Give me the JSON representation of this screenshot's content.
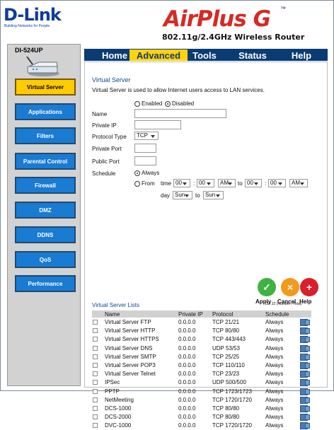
{
  "brand": {
    "name": "D-Link",
    "tagline": "Building Networks for People",
    "product": "AirPlus G",
    "tm": "™",
    "subtitle": "802.11g/2.4GHz Wireless Router",
    "model": "DI-524UP"
  },
  "nav": [
    {
      "label": "Virtual Server"
    },
    {
      "label": "Applications"
    },
    {
      "label": "Filters"
    },
    {
      "label": "Parental Control"
    },
    {
      "label": "Firewall"
    },
    {
      "label": "DMZ"
    },
    {
      "label": "DDNS"
    },
    {
      "label": "QoS"
    },
    {
      "label": "Performance"
    }
  ],
  "tabs": [
    {
      "label": "Home"
    },
    {
      "label": "Advanced"
    },
    {
      "label": "Tools"
    },
    {
      "label": "Status"
    },
    {
      "label": "Help"
    }
  ],
  "form": {
    "title": "Virtual Server",
    "description": "Virtual Server is used to allow Internet users access to LAN services.",
    "enabled": "Enabled",
    "disabled": "Disabled",
    "name_label": "Name",
    "private_ip_label": "Private IP",
    "protocol_label": "Protocol Type",
    "protocol_value": "TCP",
    "private_port_label": "Private Port",
    "public_port_label": "Public Port",
    "schedule_label": "Schedule",
    "always": "Always",
    "from": "From",
    "time": "time",
    "hour1": "00",
    "minute1": "00",
    "ampm1": "AM",
    "to": "to",
    "hour2": "00",
    "minute2": "00",
    "ampm2": "AM",
    "day": "day",
    "day_from": "Sun",
    "day_to": "Sun"
  },
  "actions": [
    {
      "label": "Apply"
    },
    {
      "label": "Cancel"
    },
    {
      "label": "Help"
    }
  ],
  "list": {
    "title": "Virtual Server Lists",
    "count": "13 / 32 (Number / Total)",
    "headers": [
      "Name",
      "Private IP",
      "Protocol",
      "Schedule"
    ],
    "rows": [
      [
        "Virtual Server FTP",
        "0.0.0.0",
        "TCP 21/21",
        "Always"
      ],
      [
        "Virtual Server HTTP",
        "0.0.0.0",
        "TCP 80/80",
        "Always"
      ],
      [
        "Virtual Server HTTPS",
        "0.0.0.0",
        "TCP 443/443",
        "Always"
      ],
      [
        "Virtual Server DNS",
        "0.0.0.0",
        "UDP 53/53",
        "Always"
      ],
      [
        "Virtual Server SMTP",
        "0.0.0.0",
        "TCP 25/25",
        "Always"
      ],
      [
        "Virtual Server POP3",
        "0.0.0.0",
        "TCP 110/110",
        "Always"
      ],
      [
        "Virtual Server Telnet",
        "0.0.0.0",
        "TCP 23/23",
        "Always"
      ],
      [
        "IPSec",
        "0.0.0.0",
        "UDP 500/500",
        "Always"
      ],
      [
        "PPTP",
        "0.0.0.0",
        "TCP 1723/1723",
        "Always"
      ],
      [
        "NetMeeting",
        "0.0.0.0",
        "TCP 1720/1720",
        "Always"
      ],
      [
        "DCS-1000",
        "0.0.0.0",
        "TCP 80/80",
        "Always"
      ],
      [
        "DCS-2000",
        "0.0.0.0",
        "TCP 80/80",
        "Always"
      ],
      [
        "DVC-1000",
        "0.0.0.0",
        "TCP 1720/1720",
        "Always"
      ]
    ]
  },
  "colors": {
    "brand": "#0f3d99",
    "accent": "#d42b24",
    "tab_active": "#ffd30b",
    "nav": "#1a7bd3"
  }
}
